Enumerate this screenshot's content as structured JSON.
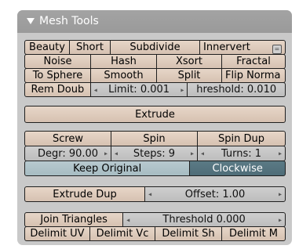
{
  "panel": {
    "title": "Mesh Tools"
  },
  "row1": {
    "beauty": "Beauty",
    "short": "Short",
    "subdivide": "Subdivide",
    "innervert": "Innervert",
    "menu_icon": "="
  },
  "row2": {
    "noise": "Noise",
    "hash": "Hash",
    "xsort": "Xsort",
    "fractal": "Fractal"
  },
  "row3": {
    "to_sphere": "To Sphere",
    "smooth": "Smooth",
    "split": "Split",
    "flip_normals": "Flip Norma"
  },
  "row4": {
    "rem_doubles": "Rem Doub",
    "limit": "Limit: 0.001",
    "threshold": "hreshold: 0.010"
  },
  "extrude": "Extrude",
  "spin": {
    "screw": "Screw",
    "spin": "Spin",
    "spin_dup": "Spin Dup",
    "degr": "Degr: 90.00",
    "steps": "Steps: 9",
    "turns": "Turns: 1",
    "keep_original": "Keep Original",
    "clockwise": "Clockwise"
  },
  "extrude_dup": {
    "label": "Extrude Dup",
    "offset": "Offset: 1.00"
  },
  "join": {
    "label": "Join Triangles",
    "threshold": "Threshold 0.000"
  },
  "delimit": {
    "uv": "Delimit UV",
    "vc": "Delimit Vc",
    "sh": "Delimit Sh",
    "m": "Delimit M"
  },
  "arrows": {
    "left": "◂",
    "right": "▸"
  }
}
